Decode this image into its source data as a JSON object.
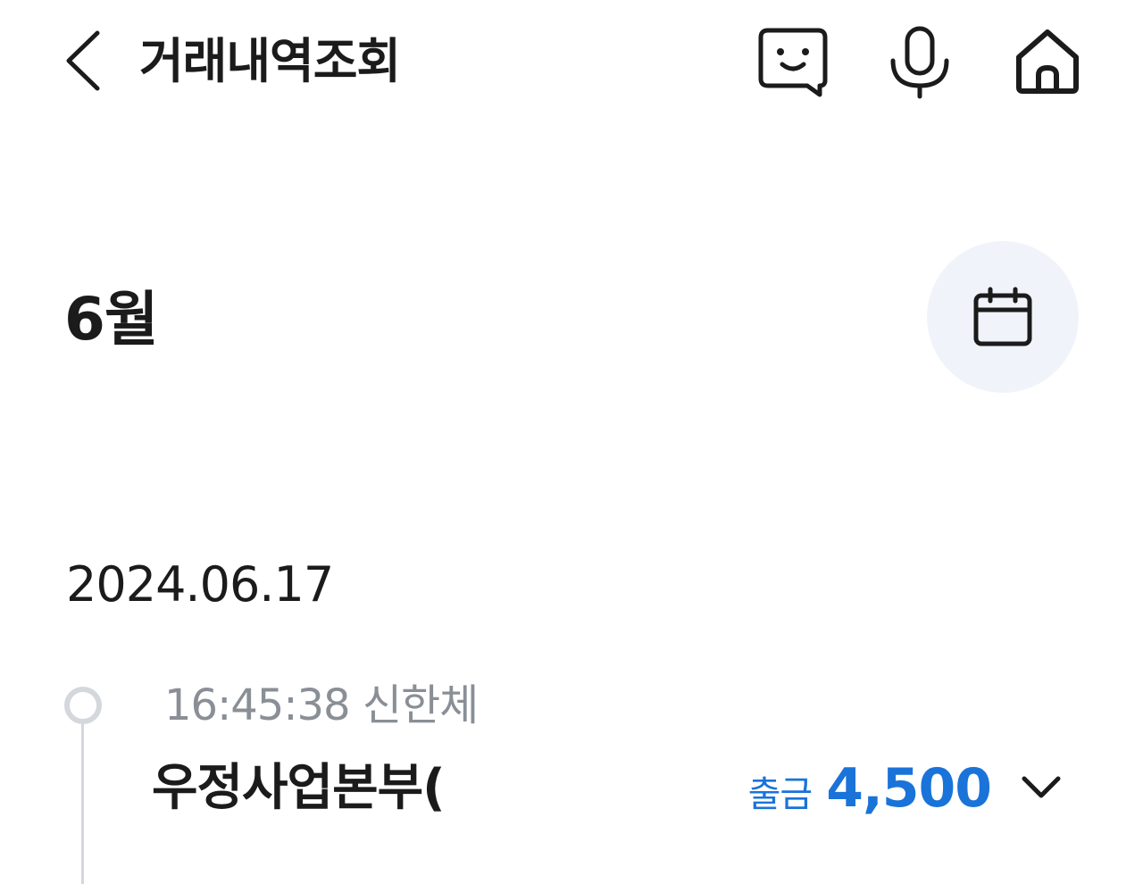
{
  "header": {
    "title": "거래내역조회",
    "back_icon": "chevron-left-icon",
    "actions": [
      {
        "name": "chatbot",
        "icon": "chat-face-icon"
      },
      {
        "name": "voice",
        "icon": "microphone-icon"
      },
      {
        "name": "home",
        "icon": "home-icon"
      }
    ]
  },
  "period": {
    "month_label": "6월",
    "calendar_icon": "calendar-icon",
    "calendar_bg_color": "#f0f4fa"
  },
  "transactions": {
    "date": "2024.06.17",
    "items": [
      {
        "time_and_bank": "16:45:38 신한체",
        "name": "우정사업본부(",
        "type": "출금",
        "amount": "4,500",
        "expand_icon": "chevron-down-icon"
      }
    ]
  },
  "colors": {
    "accent": "#1a73d9",
    "text_primary": "#1b1b1b",
    "text_secondary": "#8a8f96",
    "timeline": "#d4d7dc"
  }
}
